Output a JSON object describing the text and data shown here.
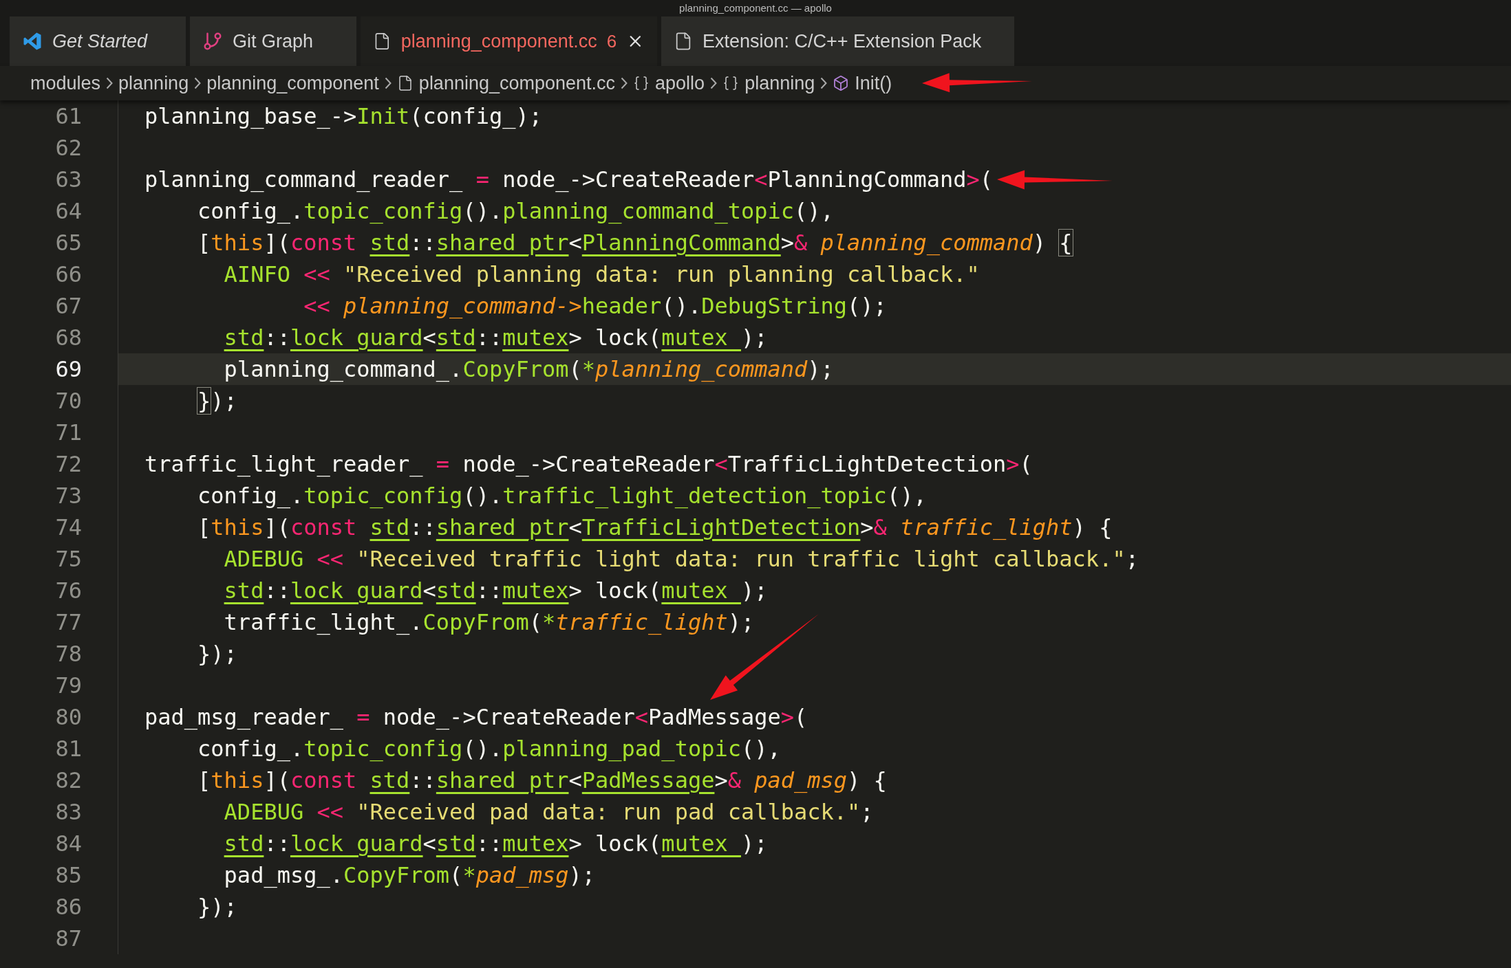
{
  "window": {
    "title": "planning_component.cc — apollo"
  },
  "tabs": [
    {
      "label": "Get Started",
      "kind": "welcome",
      "selected": false,
      "preview": true,
      "errors": false
    },
    {
      "label": "Git Graph",
      "kind": "graph",
      "selected": false,
      "preview": false,
      "errors": false
    },
    {
      "label": "planning_component.cc",
      "badge": "6",
      "kind": "file",
      "selected": true,
      "preview": false,
      "errors": true
    },
    {
      "label": "Extension: C/C++ Extension Pack",
      "kind": "file",
      "selected": false,
      "preview": false,
      "errors": false
    }
  ],
  "breadcrumbs": [
    {
      "label": "modules",
      "kind": "folder"
    },
    {
      "label": "planning",
      "kind": "folder"
    },
    {
      "label": "planning_component",
      "kind": "folder"
    },
    {
      "label": "planning_component.cc",
      "kind": "file"
    },
    {
      "label": "apollo",
      "kind": "namespace"
    },
    {
      "label": "planning",
      "kind": "namespace"
    },
    {
      "label": "Init()",
      "kind": "method"
    }
  ],
  "lines": [
    {
      "number": "61",
      "current": false,
      "tokens": [
        {
          "text": "planning_base_->",
          "kind": "plain"
        },
        {
          "text": "Init",
          "kind": "function"
        },
        {
          "text": "(config_);",
          "kind": "plain"
        }
      ]
    },
    {
      "number": "62",
      "current": false
    },
    {
      "number": "63",
      "current": false,
      "tokens": [
        {
          "text": "planning_command_reader_ ",
          "kind": "plain"
        },
        {
          "text": "=",
          "kind": "keyword"
        },
        {
          "text": " node_->CreateReader",
          "kind": "plain"
        },
        {
          "text": "<",
          "kind": "keyword"
        },
        {
          "text": "PlanningCommand",
          "kind": "plain"
        },
        {
          "text": ">",
          "kind": "keyword"
        },
        {
          "text": "(",
          "kind": "plain"
        }
      ]
    },
    {
      "number": "64",
      "current": false,
      "tokens": [
        {
          "text": "    config_.",
          "kind": "plain"
        },
        {
          "text": "topic_config",
          "kind": "function"
        },
        {
          "text": "().",
          "kind": "plain"
        },
        {
          "text": "planning_command_topic",
          "kind": "function"
        },
        {
          "text": "(),",
          "kind": "plain"
        }
      ]
    },
    {
      "number": "65",
      "current": false,
      "tokens": [
        {
          "text": "    [",
          "kind": "plain"
        },
        {
          "text": "this",
          "kind": "this"
        },
        {
          "text": "](",
          "kind": "plain"
        },
        {
          "text": "const ",
          "kind": "keyword"
        },
        {
          "text": "std",
          "kind": "type"
        },
        {
          "text": "::",
          "kind": "plain"
        },
        {
          "text": "shared_ptr",
          "kind": "type"
        },
        {
          "text": "<",
          "kind": "plain"
        },
        {
          "text": "PlanningCommand",
          "kind": "type"
        },
        {
          "text": ">",
          "kind": "plain"
        },
        {
          "text": "& ",
          "kind": "keyword"
        },
        {
          "text": "planning_command",
          "kind": "param"
        },
        {
          "text": ") ",
          "kind": "plain"
        },
        {
          "text": "{",
          "kind": "match"
        }
      ]
    },
    {
      "number": "66",
      "current": false,
      "tokens": [
        {
          "text": "      AINFO ",
          "kind": "function"
        },
        {
          "text": "<< ",
          "kind": "keyword"
        },
        {
          "text": "\"Received planning data: run planning callback.\"",
          "kind": "string"
        }
      ]
    },
    {
      "number": "67",
      "current": false,
      "tokens": [
        {
          "text": "            << ",
          "kind": "keyword"
        },
        {
          "text": "planning_command->",
          "kind": "param"
        },
        {
          "text": "header",
          "kind": "function"
        },
        {
          "text": "().",
          "kind": "plain"
        },
        {
          "text": "DebugString",
          "kind": "function"
        },
        {
          "text": "();",
          "kind": "plain"
        }
      ]
    },
    {
      "number": "68",
      "current": false,
      "tokens": [
        {
          "text": "      std",
          "kind": "type"
        },
        {
          "text": "::",
          "kind": "plain"
        },
        {
          "text": "lock_guard",
          "kind": "type"
        },
        {
          "text": "<",
          "kind": "plain"
        },
        {
          "text": "std",
          "kind": "type"
        },
        {
          "text": "::",
          "kind": "plain"
        },
        {
          "text": "mutex",
          "kind": "type"
        },
        {
          "text": "> lock(",
          "kind": "plain"
        },
        {
          "text": "mutex_",
          "kind": "type"
        },
        {
          "text": ");",
          "kind": "plain"
        }
      ]
    },
    {
      "number": "69",
      "current": true,
      "tokens": [
        {
          "text": "      planning_command_.",
          "kind": "plain"
        },
        {
          "text": "CopyFrom",
          "kind": "function"
        },
        {
          "text": "(",
          "kind": "plain"
        },
        {
          "text": "*",
          "kind": "function"
        },
        {
          "text": "planning_command",
          "kind": "param"
        },
        {
          "text": ");",
          "kind": "plain"
        }
      ]
    },
    {
      "number": "70",
      "current": false,
      "tokens": [
        {
          "text": "    }",
          "kind": "match"
        },
        {
          "text": ");",
          "kind": "plain"
        }
      ]
    },
    {
      "number": "71",
      "current": false
    },
    {
      "number": "72",
      "current": false,
      "tokens": [
        {
          "text": "traffic_light_reader_ ",
          "kind": "plain"
        },
        {
          "text": "=",
          "kind": "keyword"
        },
        {
          "text": " node_->CreateReader",
          "kind": "plain"
        },
        {
          "text": "<",
          "kind": "keyword"
        },
        {
          "text": "TrafficLightDetection",
          "kind": "plain"
        },
        {
          "text": ">",
          "kind": "keyword"
        },
        {
          "text": "(",
          "kind": "plain"
        }
      ]
    },
    {
      "number": "73",
      "current": false,
      "tokens": [
        {
          "text": "    config_.",
          "kind": "plain"
        },
        {
          "text": "topic_config",
          "kind": "function"
        },
        {
          "text": "().",
          "kind": "plain"
        },
        {
          "text": "traffic_light_detection_topic",
          "kind": "function"
        },
        {
          "text": "(),",
          "kind": "plain"
        }
      ]
    },
    {
      "number": "74",
      "current": false,
      "tokens": [
        {
          "text": "    [",
          "kind": "plain"
        },
        {
          "text": "this",
          "kind": "this"
        },
        {
          "text": "](",
          "kind": "plain"
        },
        {
          "text": "const ",
          "kind": "keyword"
        },
        {
          "text": "std",
          "kind": "type"
        },
        {
          "text": "::",
          "kind": "plain"
        },
        {
          "text": "shared_ptr",
          "kind": "type"
        },
        {
          "text": "<",
          "kind": "plain"
        },
        {
          "text": "TrafficLightDetection",
          "kind": "type"
        },
        {
          "text": ">",
          "kind": "plain"
        },
        {
          "text": "& ",
          "kind": "keyword"
        },
        {
          "text": "traffic_light",
          "kind": "param"
        },
        {
          "text": ") {",
          "kind": "plain"
        }
      ]
    },
    {
      "number": "75",
      "current": false,
      "tokens": [
        {
          "text": "      ADEBUG ",
          "kind": "function"
        },
        {
          "text": "<< ",
          "kind": "keyword"
        },
        {
          "text": "\"Received traffic light data: run traffic light callback.\"",
          "kind": "string"
        },
        {
          "text": ";",
          "kind": "plain"
        }
      ]
    },
    {
      "number": "76",
      "current": false,
      "tokens": [
        {
          "text": "      std",
          "kind": "type"
        },
        {
          "text": "::",
          "kind": "plain"
        },
        {
          "text": "lock_guard",
          "kind": "type"
        },
        {
          "text": "<",
          "kind": "plain"
        },
        {
          "text": "std",
          "kind": "type"
        },
        {
          "text": "::",
          "kind": "plain"
        },
        {
          "text": "mutex",
          "kind": "type"
        },
        {
          "text": "> lock(",
          "kind": "plain"
        },
        {
          "text": "mutex_",
          "kind": "type"
        },
        {
          "text": ");",
          "kind": "plain"
        }
      ]
    },
    {
      "number": "77",
      "current": false,
      "tokens": [
        {
          "text": "      traffic_light_.",
          "kind": "plain"
        },
        {
          "text": "CopyFrom",
          "kind": "function"
        },
        {
          "text": "(",
          "kind": "plain"
        },
        {
          "text": "*",
          "kind": "function"
        },
        {
          "text": "traffic_light",
          "kind": "param"
        },
        {
          "text": ");",
          "kind": "plain"
        }
      ]
    },
    {
      "number": "78",
      "current": false,
      "tokens": [
        {
          "text": "    });",
          "kind": "plain"
        }
      ]
    },
    {
      "number": "79",
      "current": false
    },
    {
      "number": "80",
      "current": false,
      "tokens": [
        {
          "text": "pad_msg_reader_ ",
          "kind": "plain"
        },
        {
          "text": "=",
          "kind": "keyword"
        },
        {
          "text": " node_->CreateReader",
          "kind": "plain"
        },
        {
          "text": "<",
          "kind": "keyword"
        },
        {
          "text": "PadMessage",
          "kind": "plain"
        },
        {
          "text": ">",
          "kind": "keyword"
        },
        {
          "text": "(",
          "kind": "plain"
        }
      ]
    },
    {
      "number": "81",
      "current": false,
      "tokens": [
        {
          "text": "    config_.",
          "kind": "plain"
        },
        {
          "text": "topic_config",
          "kind": "function"
        },
        {
          "text": "().",
          "kind": "plain"
        },
        {
          "text": "planning_pad_topic",
          "kind": "function"
        },
        {
          "text": "(),",
          "kind": "plain"
        }
      ]
    },
    {
      "number": "82",
      "current": false,
      "tokens": [
        {
          "text": "    [",
          "kind": "plain"
        },
        {
          "text": "this",
          "kind": "this"
        },
        {
          "text": "](",
          "kind": "plain"
        },
        {
          "text": "const ",
          "kind": "keyword"
        },
        {
          "text": "std",
          "kind": "type"
        },
        {
          "text": "::",
          "kind": "plain"
        },
        {
          "text": "shared_ptr",
          "kind": "type"
        },
        {
          "text": "<",
          "kind": "plain"
        },
        {
          "text": "PadMessage",
          "kind": "type"
        },
        {
          "text": ">",
          "kind": "plain"
        },
        {
          "text": "& ",
          "kind": "keyword"
        },
        {
          "text": "pad_msg",
          "kind": "param"
        },
        {
          "text": ") {",
          "kind": "plain"
        }
      ]
    },
    {
      "number": "83",
      "current": false,
      "tokens": [
        {
          "text": "      ADEBUG ",
          "kind": "function"
        },
        {
          "text": "<< ",
          "kind": "keyword"
        },
        {
          "text": "\"Received pad data: run pad callback.\"",
          "kind": "string"
        },
        {
          "text": ";",
          "kind": "plain"
        }
      ]
    },
    {
      "number": "84",
      "current": false,
      "tokens": [
        {
          "text": "      std",
          "kind": "type"
        },
        {
          "text": "::",
          "kind": "plain"
        },
        {
          "text": "lock_guard",
          "kind": "type"
        },
        {
          "text": "<",
          "kind": "plain"
        },
        {
          "text": "std",
          "kind": "type"
        },
        {
          "text": "::",
          "kind": "plain"
        },
        {
          "text": "mutex",
          "kind": "type"
        },
        {
          "text": "> lock(",
          "kind": "plain"
        },
        {
          "text": "mutex_",
          "kind": "type"
        },
        {
          "text": ");",
          "kind": "plain"
        }
      ]
    },
    {
      "number": "85",
      "current": false,
      "tokens": [
        {
          "text": "      pad_msg_.",
          "kind": "plain"
        },
        {
          "text": "CopyFrom",
          "kind": "function"
        },
        {
          "text": "(",
          "kind": "plain"
        },
        {
          "text": "*",
          "kind": "function"
        },
        {
          "text": "pad_msg",
          "kind": "param"
        },
        {
          "text": ");",
          "kind": "plain"
        }
      ]
    },
    {
      "number": "86",
      "current": false,
      "tokens": [
        {
          "text": "    });",
          "kind": "plain"
        }
      ]
    },
    {
      "number": "87",
      "current": false
    }
  ]
}
